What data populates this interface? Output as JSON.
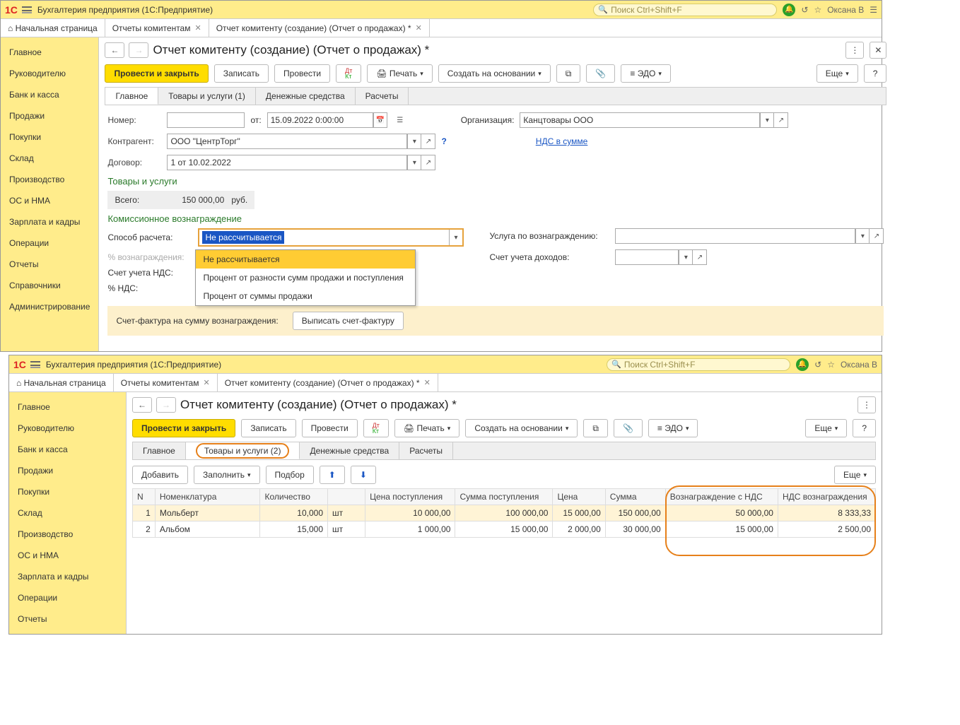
{
  "titlebar": {
    "title": "Бухгалтерия предприятия  (1С:Предприятие)",
    "search_placeholder": "Поиск Ctrl+Shift+F",
    "user": "Оксана В"
  },
  "tabs": {
    "home": "Начальная страница",
    "t1": "Отчеты комитентам",
    "t2": "Отчет комитенту (создание) (Отчет о продажах) *"
  },
  "sidebar": {
    "items": [
      "Главное",
      "Руководителю",
      "Банк и касса",
      "Продажи",
      "Покупки",
      "Склад",
      "Производство",
      "ОС и НМА",
      "Зарплата и кадры",
      "Операции",
      "Отчеты",
      "Справочники",
      "Администрирование"
    ]
  },
  "page": {
    "title": "Отчет комитенту (создание) (Отчет о продажах) *"
  },
  "toolbar": {
    "post_close": "Провести и закрыть",
    "save": "Записать",
    "post": "Провести",
    "print": "Печать",
    "create_based": "Создать на основании",
    "edo": "ЭДО",
    "more": "Еще"
  },
  "subtabs_top": [
    "Главное",
    "Товары и услуги (1)",
    "Денежные средства",
    "Расчеты"
  ],
  "subtabs_bottom": [
    "Главное",
    "Товары и услуги (2)",
    "Денежные средства",
    "Расчеты"
  ],
  "form": {
    "number_label": "Номер:",
    "number_value": "",
    "from_label": "от:",
    "date_value": "15.09.2022  0:00:00",
    "org_label": "Организация:",
    "org_value": "Канцтовары ООО",
    "counterparty_label": "Контрагент:",
    "counterparty_value": "ООО \"ЦентрТорг\"",
    "nds_link": "НДС в сумме",
    "contract_label": "Договор:",
    "contract_value": "1 от 10.02.2022",
    "goods_section": "Товары и услуги",
    "total_label": "Всего:",
    "total_value": "150 000,00",
    "currency": "руб.",
    "commission_section": "Комиссионное вознаграждение",
    "calc_method_label": "Способ расчета:",
    "calc_method_value": "Не рассчитывается",
    "calc_options": [
      "Не рассчитывается",
      "Процент от разности сумм продажи и поступления",
      "Процент от суммы продажи"
    ],
    "service_label": "Услуга по вознаграждению:",
    "percent_label": "% вознаграждения:",
    "income_acc_label": "Счет учета доходов:",
    "nds_acc_label": "Счет учета НДС:",
    "nds_percent_label": "% НДС:",
    "invoice_label": "Счет-фактура на сумму вознаграждения:",
    "invoice_btn": "Выписать счет-фактуру"
  },
  "goods_toolbar": {
    "add": "Добавить",
    "fill": "Заполнить",
    "pick": "Подбор",
    "more": "Еще"
  },
  "goods_table": {
    "headers": [
      "N",
      "Номенклатура",
      "Количество",
      "",
      "Цена поступления",
      "Сумма поступления",
      "Цена",
      "Сумма",
      "Вознаграждение с НДС",
      "НДС вознаграждения"
    ],
    "rows": [
      {
        "n": "1",
        "nom": "Мольберт",
        "qty": "10,000",
        "unit": "шт",
        "pprice": "10 000,00",
        "psum": "100 000,00",
        "price": "15 000,00",
        "sum": "150 000,00",
        "fee": "50 000,00",
        "fee_nds": "8 333,33"
      },
      {
        "n": "2",
        "nom": "Альбом",
        "qty": "15,000",
        "unit": "шт",
        "pprice": "1 000,00",
        "psum": "15 000,00",
        "price": "2 000,00",
        "sum": "30 000,00",
        "fee": "15 000,00",
        "fee_nds": "2 500,00"
      }
    ]
  },
  "sidebar_bottom_items": [
    "Главное",
    "Руководителю",
    "Банк и касса",
    "Продажи",
    "Покупки",
    "Склад",
    "Производство",
    "ОС и НМА",
    "Зарплата и кадры",
    "Операции",
    "Отчеты"
  ]
}
